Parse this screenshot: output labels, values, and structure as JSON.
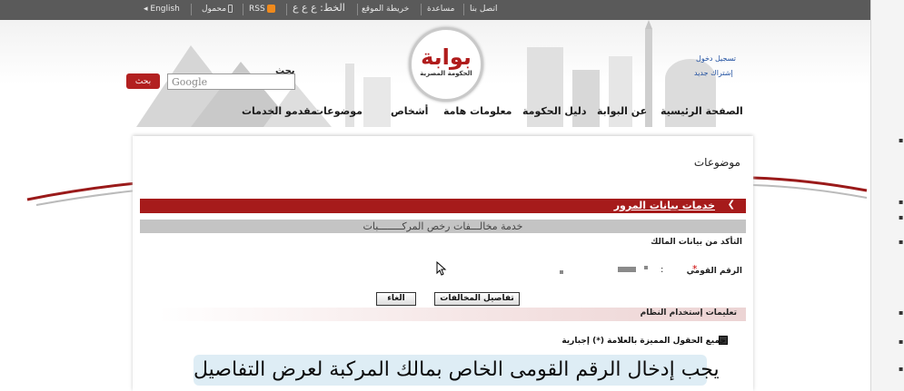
{
  "topbar": {
    "english": "◂ English",
    "mobile": "محمول",
    "rss": "RSS",
    "font_label": "الخط: ع ع ع",
    "sitemap": "خريطة الموقع",
    "help": "مساعدة",
    "contact": "اتصل بنا"
  },
  "header": {
    "logo_main": "بوابة",
    "logo_sub": "الحكومة المصرية",
    "search_label": "بحث",
    "search_placeholder": "Google",
    "search_button": "بحث",
    "login": "تسجيل دخول",
    "register": "إشتراك جديد"
  },
  "nav": {
    "home": "الصفحة الرئيسية",
    "about": "عن البوابة",
    "gov_guide": "دليل الحكومة",
    "important_info": "معلومات هامة",
    "people": "أشخاص",
    "topics": "موضوعات",
    "service_providers": "مقدمو الخدمات"
  },
  "content": {
    "section_title": "موضوعات",
    "breadcrumb_link": "خدمات بيانات المرور",
    "service_title": "خدمة مخالـــفات رخص المركــــــــبات",
    "owner_check": "التأكد من بيانات المالك",
    "nid_label": "الرقم القومي",
    "required_star": "*",
    "colon": ":",
    "details_button": "تفاصيل المخالفات",
    "cancel_button": "الغاء",
    "instructions": "تعليمات إستخدام النظام",
    "required_note": "جميع الحقول المميزة بالعلامة (*) إجبارية"
  },
  "caption": "يجب إدخال الرقم القومى الخاص بمالك المركبة لعرض التفاصيل",
  "colors": {
    "topbar": "#5a5a5a",
    "accent_red": "#a61b1b",
    "gray_bar": "#c4c4c4",
    "link_blue": "#1f4fa0"
  }
}
